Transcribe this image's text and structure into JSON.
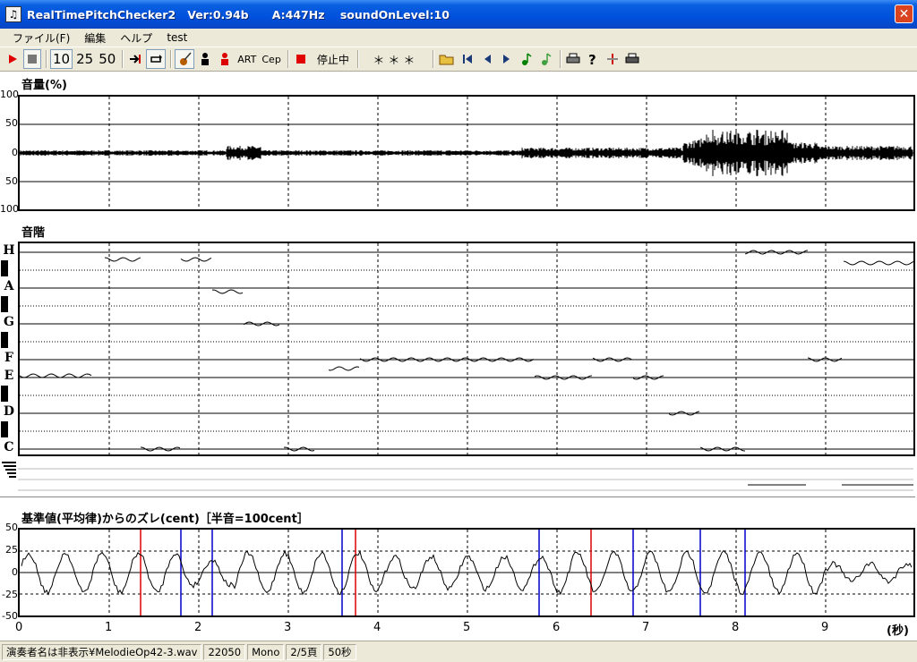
{
  "window": {
    "title": "RealTimePitchChecker2   Ver:0.94b      A:447Hz    soundOnLevel:10",
    "close_label": "✕"
  },
  "menu": [
    "ファイル(F)",
    "編集",
    "ヘルプ",
    "test"
  ],
  "toolbar": {
    "span_options": [
      "10",
      "25",
      "50"
    ],
    "art_label": "ART",
    "cep_label": "Cep",
    "status_text": "停止中",
    "notes_text": "＊＊＊"
  },
  "panels": {
    "volume_title": "音量(%)",
    "volume_ticks": [
      "100",
      "50",
      "0",
      "50",
      "100"
    ],
    "pitch_title": "音階",
    "note_labels": [
      "H",
      "A",
      "G",
      "F",
      "E",
      "D",
      "C"
    ],
    "cent_title": "基準値(平均律)からのズレ(cent)［半音=100cent］",
    "cent_ticks": [
      "50",
      "25",
      "0",
      "-25",
      "-50"
    ]
  },
  "time_axis": {
    "ticks": [
      "0",
      "1",
      "2",
      "3",
      "4",
      "5",
      "6",
      "7",
      "8",
      "9"
    ],
    "unit": "(秒)"
  },
  "status_bar": {
    "file": "演奏者名は非表示¥MelodieOp42-3.wav",
    "rate": "22050",
    "channels": "Mono",
    "page": "2/5頁",
    "length": "50秒"
  },
  "colors": {
    "title_bar": "#0050dc",
    "chrome": "#ece9d8",
    "marker_red": "#e00000",
    "marker_blue": "#0000cc"
  },
  "pitch_segments": [
    {
      "note": "E",
      "start": 0.0,
      "end": 0.8,
      "cent": 10
    },
    {
      "note": "C",
      "start": 1.35,
      "end": 1.8,
      "cent": 0
    },
    {
      "note": "H",
      "start": 0.95,
      "end": 1.35,
      "cent": -40
    },
    {
      "note": "H",
      "start": 1.8,
      "end": 2.15,
      "cent": -40
    },
    {
      "note": "A",
      "start": 2.15,
      "end": 2.5,
      "cent": -20
    },
    {
      "note": "G",
      "start": 2.5,
      "end": 2.9,
      "cent": 0
    },
    {
      "note": "C",
      "start": 2.95,
      "end": 3.3,
      "cent": 0
    },
    {
      "note": "F",
      "start": 3.45,
      "end": 3.8,
      "cent": -50
    },
    {
      "note": "F",
      "start": 3.8,
      "end": 5.75,
      "cent": 0
    },
    {
      "note": "E",
      "start": 5.75,
      "end": 6.4,
      "cent": 0
    },
    {
      "note": "F",
      "start": 6.4,
      "end": 6.85,
      "cent": 0
    },
    {
      "note": "E",
      "start": 6.85,
      "end": 7.2,
      "cent": 0
    },
    {
      "note": "D",
      "start": 7.25,
      "end": 7.6,
      "cent": 0
    },
    {
      "note": "C",
      "start": 7.6,
      "end": 8.1,
      "cent": 0
    },
    {
      "note": "H",
      "start": 8.1,
      "end": 8.8,
      "cent": 0
    },
    {
      "note": "F",
      "start": 8.8,
      "end": 9.2,
      "cent": 0
    },
    {
      "note": "H",
      "start": 9.2,
      "end": 10.0,
      "cent": -60
    }
  ],
  "markers": [
    {
      "t": 1.35,
      "color": "red"
    },
    {
      "t": 1.8,
      "color": "blue"
    },
    {
      "t": 2.15,
      "color": "blue"
    },
    {
      "t": 3.6,
      "color": "blue"
    },
    {
      "t": 3.75,
      "color": "red"
    },
    {
      "t": 5.8,
      "color": "blue"
    },
    {
      "t": 6.38,
      "color": "red"
    },
    {
      "t": 6.85,
      "color": "blue"
    },
    {
      "t": 7.6,
      "color": "blue"
    },
    {
      "t": 8.1,
      "color": "blue"
    }
  ]
}
